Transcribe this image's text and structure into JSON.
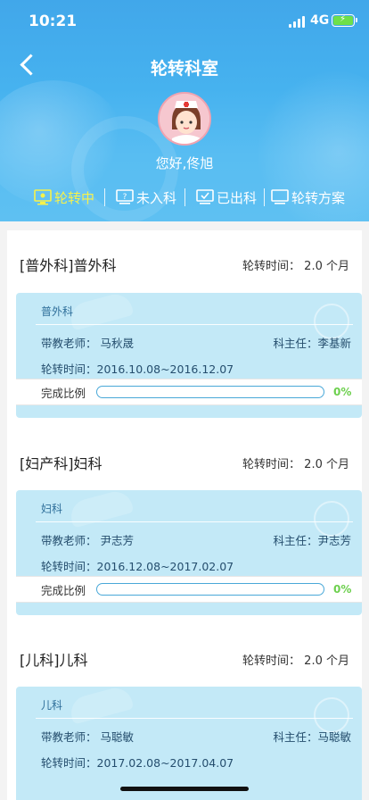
{
  "status": {
    "time": "10:21",
    "network": "4G"
  },
  "nav": {
    "title": "轮转科室"
  },
  "user": {
    "greeting": "您好,佟旭"
  },
  "tabs": [
    {
      "label": "轮转中",
      "icon": "monitor-icon",
      "active": true
    },
    {
      "label": "未入科",
      "icon": "question-monitor-icon",
      "active": false
    },
    {
      "label": "已出科",
      "icon": "check-monitor-icon",
      "active": false
    },
    {
      "label": "轮转方案",
      "icon": "monitor-icon",
      "active": false
    }
  ],
  "departments": [
    {
      "heading": "[普外科]普外科",
      "duration": "轮转时间：  2.0 个月",
      "card_name": "普外科",
      "teacher": "带教老师：  马秋晟",
      "director": "科主任：李基新",
      "period": "轮转时间：2016.10.08~2016.12.07",
      "progress_label": "完成比例",
      "progress_pct": "0%",
      "progress_value": 0
    },
    {
      "heading": "[妇产科]妇科",
      "duration": "轮转时间：  2.0 个月",
      "card_name": "妇科",
      "teacher": "带教老师：  尹志芳",
      "director": "科主任：尹志芳",
      "period": "轮转时间：2016.12.08~2017.02.07",
      "progress_label": "完成比例",
      "progress_pct": "0%",
      "progress_value": 0
    },
    {
      "heading": "[儿科]儿科",
      "duration": "轮转时间：  2.0 个月",
      "card_name": "儿科",
      "teacher": "带教老师：  马聪敏",
      "director": "科主任：马聪敏",
      "period": "轮转时间：2017.02.08~2017.04.07"
    }
  ],
  "colors": {
    "header": "#46b2ef",
    "active_tab": "#f7f24a",
    "card": "#c3e9f7",
    "progress_pct": "#6dd04e"
  }
}
